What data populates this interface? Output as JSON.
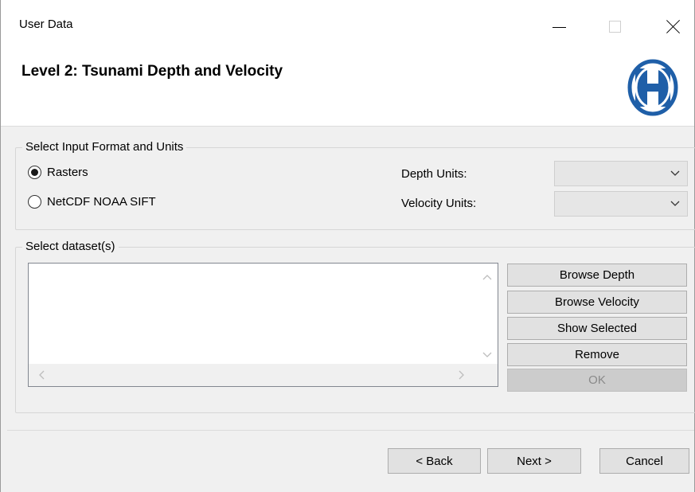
{
  "window": {
    "title": "User Data",
    "controls": {
      "minimize": "minimize-icon",
      "maximize": "maximize-icon",
      "close": "close-icon"
    }
  },
  "header": {
    "title": "Level 2: Tsunami Depth and Velocity",
    "logo": "hazus-h-logo",
    "logo_color": "#1f5fa8"
  },
  "input_format": {
    "legend": "Select Input Format and Units",
    "options": [
      {
        "label": "Rasters",
        "selected": true
      },
      {
        "label": "NetCDF NOAA SIFT",
        "selected": false
      }
    ],
    "depth_units_label": "Depth Units:",
    "depth_units_value": "",
    "velocity_units_label": "Velocity Units:",
    "velocity_units_value": ""
  },
  "datasets": {
    "legend": "Select dataset(s)",
    "items": [],
    "buttons": {
      "browse_depth": "Browse Depth",
      "browse_velocity": "Browse Velocity",
      "show_selected": "Show Selected",
      "remove": "Remove",
      "ok": "OK"
    }
  },
  "footer": {
    "back": "< Back",
    "next": "Next >",
    "cancel": "Cancel"
  }
}
